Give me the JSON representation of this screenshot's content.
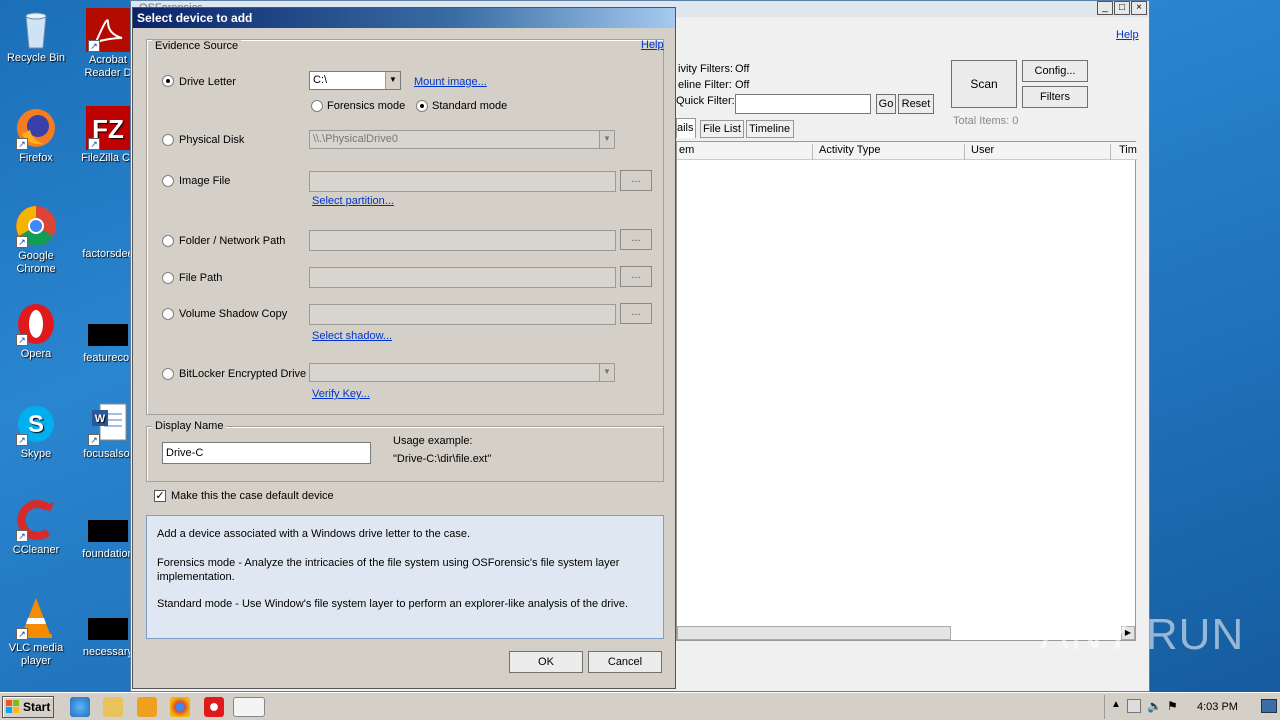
{
  "desktop": {
    "icons": [
      {
        "label": "Recycle Bin"
      },
      {
        "label": "Firefox"
      },
      {
        "label": "Google Chrome"
      },
      {
        "label": "Opera"
      },
      {
        "label": "Skype"
      },
      {
        "label": "CCleaner"
      },
      {
        "label": "VLC media player"
      },
      {
        "label": "Acrobat Reader D"
      },
      {
        "label": "FileZilla Cli"
      },
      {
        "label": "factorsdee"
      },
      {
        "label": "featurecor"
      },
      {
        "label": "focusalso."
      },
      {
        "label": "foundation"
      },
      {
        "label": "necessary"
      }
    ]
  },
  "main_window": {
    "title": "OSForensics",
    "help_label": "Help",
    "activity_filters_label": "ivity Filters:",
    "activity_filters_value": "Off",
    "timeline_filter_label": "eline Filter:",
    "timeline_filter_value": "Off",
    "quick_filter_label": "Quick Filter:",
    "quick_filter_value": "",
    "go_label": "Go",
    "reset_label": "Reset",
    "scan_label": "Scan",
    "config_label": "Config...",
    "filters_label": "Filters",
    "total_items": "Total Items: 0",
    "tabs": [
      "ails",
      "File List",
      "Timeline"
    ],
    "columns": [
      "em",
      "Activity Type",
      "User",
      "Tim"
    ]
  },
  "dialog": {
    "title": "Select device to add",
    "evidence_source_label": "Evidence Source",
    "help_label": "Help",
    "drive_letter_label": "Drive Letter",
    "drive_letter_value": "C:\\",
    "mount_image_label": "Mount image...",
    "forensics_mode_label": "Forensics mode",
    "standard_mode_label": "Standard mode",
    "physical_disk_label": "Physical Disk",
    "physical_disk_value": "\\\\.\\PhysicalDrive0",
    "image_file_label": "Image File",
    "image_file_value": "",
    "select_partition_label": "Select partition...",
    "folder_path_label": "Folder / Network Path",
    "folder_path_value": "",
    "file_path_label": "File Path",
    "file_path_value": "",
    "vsc_label": "Volume Shadow Copy",
    "vsc_value": "",
    "select_shadow_label": "Select shadow...",
    "bitlocker_label": "BitLocker Encrypted Drive",
    "bitlocker_value": "",
    "verify_key_label": "Verify Key...",
    "browse_label": "...",
    "display_name_label": "Display Name",
    "display_name_value": "Drive-C",
    "usage_label": "Usage example:",
    "usage_value": "\"Drive-C:\\dir\\file.ext\"",
    "default_device_label": "Make this the case default device",
    "default_device_checked": true,
    "info_line1": "Add a device associated with a Windows drive letter to the case.",
    "info_line2": "Forensics mode - Analyze the intricacies of the file system using OSForensic's file system layer implementation.",
    "info_line3": "Standard mode - Use Window's file system layer to perform an explorer-like analysis of the drive.",
    "ok_label": "OK",
    "cancel_label": "Cancel"
  },
  "taskbar": {
    "start_label": "Start",
    "clock": "4:03 PM"
  },
  "watermark": "ANY RUN"
}
